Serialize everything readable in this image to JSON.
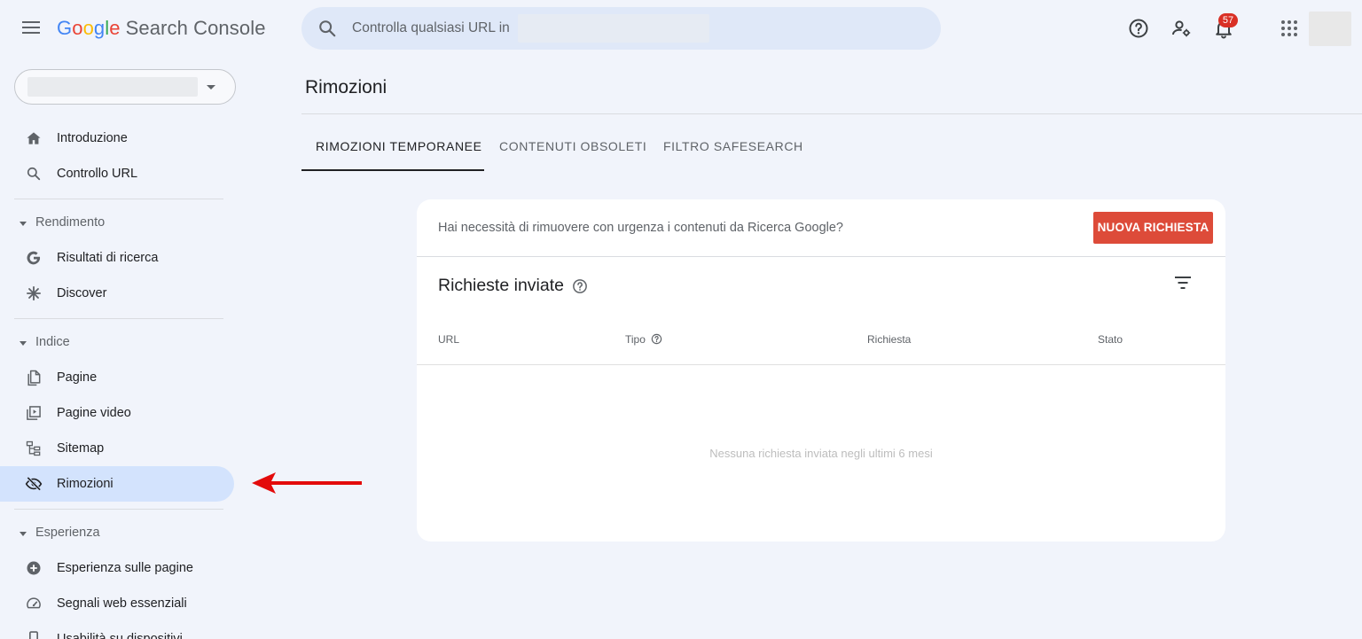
{
  "header": {
    "logo_google": "Google",
    "logo_product": "Search Console",
    "search_placeholder": "Controlla qualsiasi URL in",
    "notification_count": "57"
  },
  "sidebar": {
    "items": [
      {
        "label": "Introduzione",
        "icon": "home-icon"
      },
      {
        "label": "Controllo URL",
        "icon": "search-icon"
      },
      {
        "section": "Rendimento"
      },
      {
        "label": "Risultati di ricerca",
        "icon": "google-g-icon"
      },
      {
        "label": "Discover",
        "icon": "asterisk-icon"
      },
      {
        "section": "Indice"
      },
      {
        "label": "Pagine",
        "icon": "pages-icon"
      },
      {
        "label": "Pagine video",
        "icon": "video-pages-icon"
      },
      {
        "label": "Sitemap",
        "icon": "sitemap-icon"
      },
      {
        "label": "Rimozioni",
        "icon": "eye-off-icon",
        "active": true
      },
      {
        "section": "Esperienza"
      },
      {
        "label": "Esperienza sulle pagine",
        "icon": "plus-circle-icon"
      },
      {
        "label": "Segnali web essenziali",
        "icon": "gauge-icon"
      },
      {
        "label": "Usabilità su dispositivi",
        "icon": "mobile-icon"
      }
    ]
  },
  "main": {
    "title": "Rimozioni",
    "tabs": [
      {
        "label": "RIMOZIONI TEMPORANEE",
        "active": true
      },
      {
        "label": "CONTENUTI OBSOLETI"
      },
      {
        "label": "FILTRO SAFESEARCH"
      }
    ],
    "card": {
      "prompt": "Hai necessità di rimuovere con urgenza i contenuti da Ricerca Google?",
      "new_request_label": "NUOVA RICHIESTA",
      "section_title": "Richieste inviate",
      "columns": [
        "URL",
        "Tipo",
        "Richiesta",
        "Stato"
      ],
      "empty_message": "Nessuna richiesta inviata negli ultimi 6 mesi"
    }
  },
  "colors": {
    "background": "#f1f4fb",
    "active_nav": "#d3e3fd",
    "primary_button": "#dd4b39",
    "annotation_arrow": "#e30b0b"
  }
}
